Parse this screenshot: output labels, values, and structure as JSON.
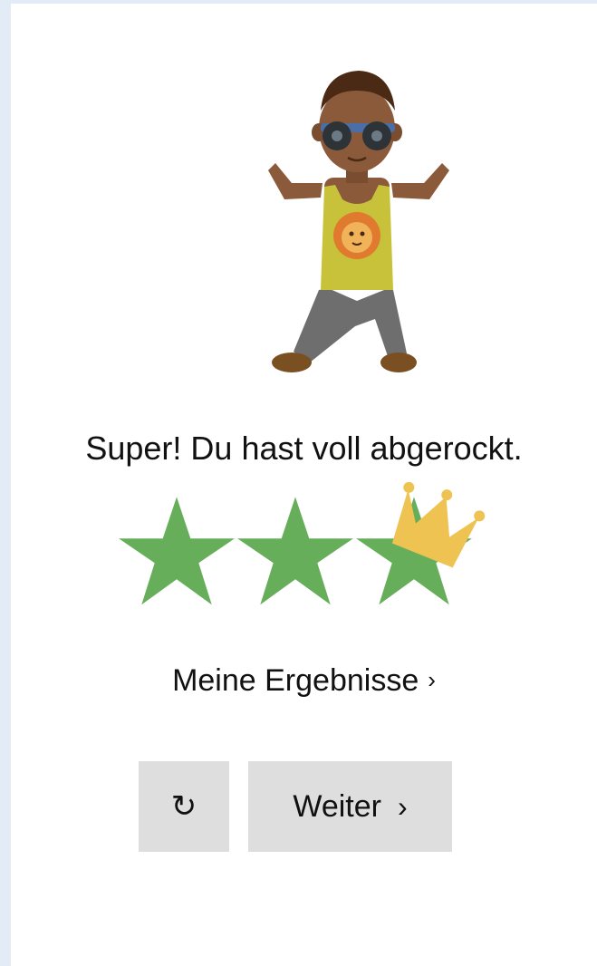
{
  "result": {
    "message": "Super! Du hast voll abgerockt.",
    "stars_earned": 3,
    "stars_total": 3,
    "crown": true
  },
  "results_link": {
    "label": "Meine Ergebnisse",
    "chevron": "›"
  },
  "buttons": {
    "replay_icon": "↻",
    "next_label": "Weiter",
    "next_chevron": "›"
  },
  "colors": {
    "star": "#67ae5b",
    "crown": "#eec351",
    "button_bg": "#dedede",
    "page_bg": "#e3ecf6"
  }
}
